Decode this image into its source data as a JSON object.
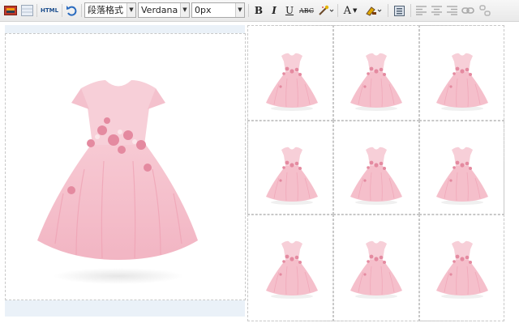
{
  "toolbar": {
    "html_label": "HTML",
    "paragraph_format": "段落格式",
    "font_family": "Verdana",
    "font_size": "0px",
    "bold": "B",
    "italic": "I",
    "underline": "U",
    "strike": "ABC",
    "font_color": "A",
    "icons": [
      "image-icon",
      "table-icon",
      "html-source-icon",
      "undo-icon",
      "clear-format-icon",
      "font-color-icon",
      "highlight-icon",
      "paste-icon",
      "align-left-icon",
      "align-center-icon",
      "align-right-icon",
      "link-icon",
      "unlink-icon"
    ]
  },
  "editor": {
    "main_product": "pink-dress-image",
    "thumbnail_count": 9
  },
  "colors": {
    "dress_pink": "#f6c4cf",
    "flower_pink": "#e48aa0",
    "grid_border": "#c8c8c8",
    "row_tint": "#eaf1f8"
  }
}
